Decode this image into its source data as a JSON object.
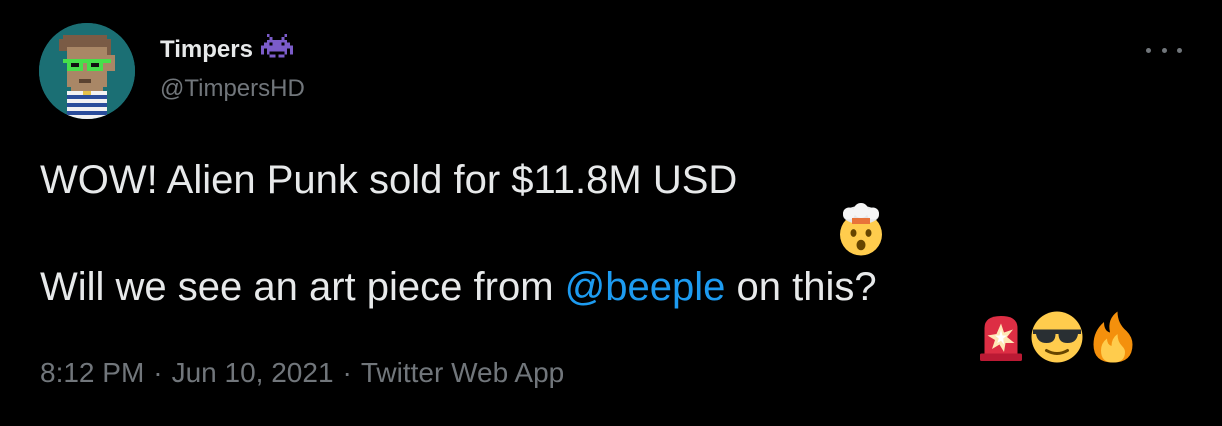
{
  "author": {
    "display_name": "Timpers",
    "handle": "@TimpersHD",
    "badge_icon": "space-invader-icon",
    "avatar_icon": "pixel-punk-avatar"
  },
  "tweet": {
    "line1_text": "WOW! Alien Punk sold for $11.8M USD",
    "line1_emoji": "exploding-head-emoji",
    "line2_prefix": "Will we see an art piece from ",
    "line2_mention": "@beeple",
    "line2_suffix": " on this?",
    "line2_emojis": [
      "police-light-emoji",
      "sunglasses-face-emoji",
      "fire-emoji"
    ]
  },
  "meta": {
    "time": "8:12 PM",
    "separator": "·",
    "date": "Jun 10, 2021",
    "source": "Twitter Web App"
  },
  "colors": {
    "background": "#000000",
    "text": "#e7e9ea",
    "muted": "#71767b",
    "link": "#1d9bf0",
    "avatar_bg": "#1b6f74"
  }
}
